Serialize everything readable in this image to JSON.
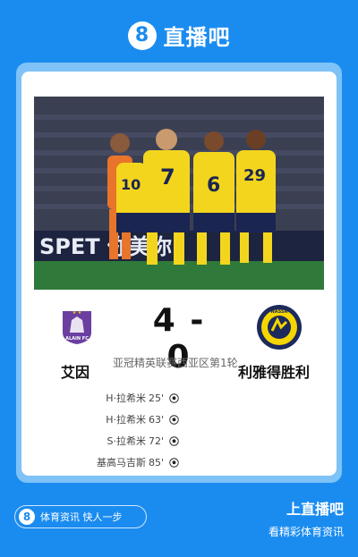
{
  "brand": {
    "logo_glyph": "8",
    "name": "直播吧"
  },
  "match": {
    "home_team": "艾因",
    "away_team": "利雅得胜利",
    "home_score": "4",
    "separator": "-",
    "away_score": "0",
    "competition": "亚冠精英联赛西亚区第1轮",
    "home_logo_text": "ALAIN FC",
    "away_logo_text": "NASSR"
  },
  "photo": {
    "banner_text": "SPET 你美你",
    "jersey_numbers": [
      "7",
      "6",
      "29",
      "10"
    ]
  },
  "scorers": [
    {
      "name": "H·拉希米",
      "minute": "25'",
      "icon": "football-icon"
    },
    {
      "name": "H·拉希米",
      "minute": "63'",
      "icon": "football-icon"
    },
    {
      "name": "S·拉希米",
      "minute": "72'",
      "icon": "football-icon"
    },
    {
      "name": "基高马吉斯",
      "minute": "85'",
      "icon": "football-icon"
    }
  ],
  "footer": {
    "logo_glyph": "8",
    "slogan": "体育资讯 快人一步",
    "cta_title": "上直播吧",
    "cta_subtitle": "看精彩体育资讯"
  },
  "colors": {
    "background": "#1a8cf0",
    "home_purple": "#6a3fa0",
    "away_yellow": "#f5d600",
    "away_blue": "#1c2a5c"
  }
}
